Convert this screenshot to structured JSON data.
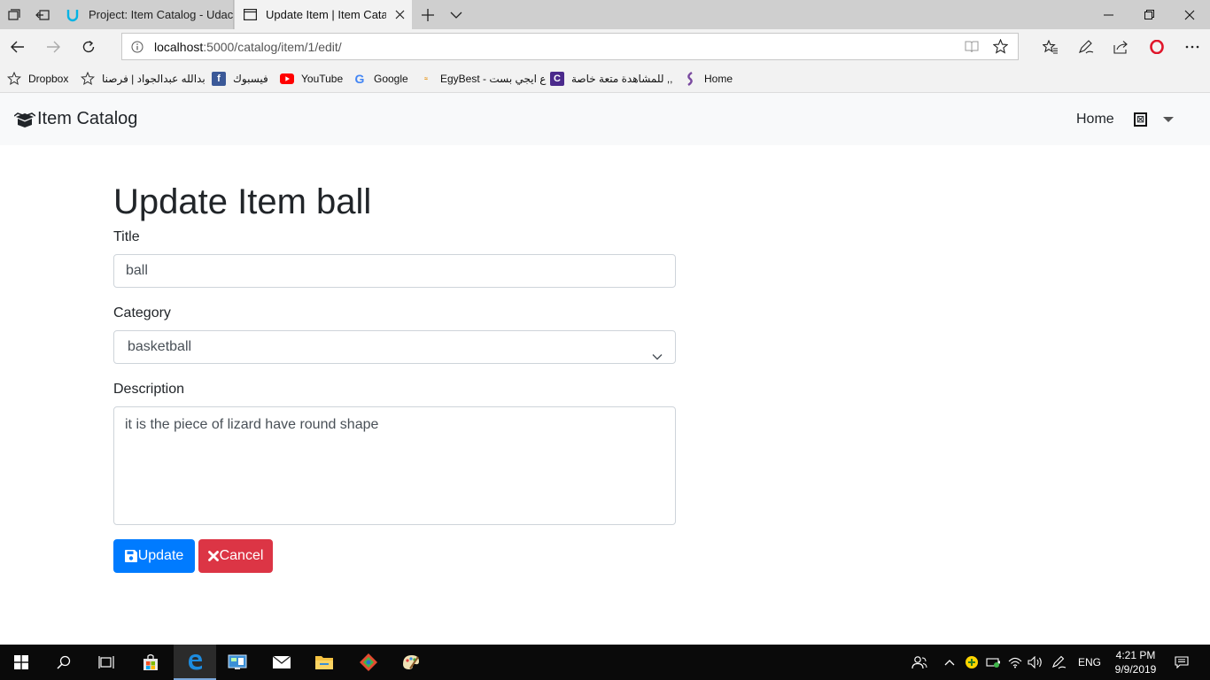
{
  "browser": {
    "tabs": [
      {
        "label": "Project: Item Catalog - Udac"
      },
      {
        "label": "Update Item | Item Cata"
      }
    ],
    "address": {
      "host": "localhost",
      "rest": ":5000/catalog/item/1/edit/"
    },
    "favorites": [
      {
        "label": "Dropbox"
      },
      {
        "label": "بدالله عبدالجواد | فرصنا"
      },
      {
        "label": "فيسبوك"
      },
      {
        "label": "YouTube"
      },
      {
        "label": "Google"
      },
      {
        "label": "EgyBest - ع ايجي بست"
      },
      {
        "label": "للمشاهدة متعة خاصة ,,"
      },
      {
        "label": "Home"
      }
    ]
  },
  "navbar": {
    "brand": "Item Catalog",
    "home_link": "Home"
  },
  "form": {
    "heading": "Update Item ball",
    "title_label": "Title",
    "title_value": "ball",
    "category_label": "Category",
    "category_value": "basketball",
    "description_label": "Description",
    "description_value": "it is the piece of lizard have round shape",
    "update_label": "Update",
    "cancel_label": "Cancel"
  },
  "taskbar": {
    "language": "ENG",
    "time": "4:21 PM",
    "date": "9/9/2019"
  },
  "colors": {
    "primary": "#007bff",
    "danger": "#dc3545",
    "navbar_bg": "#f8f9fa"
  }
}
